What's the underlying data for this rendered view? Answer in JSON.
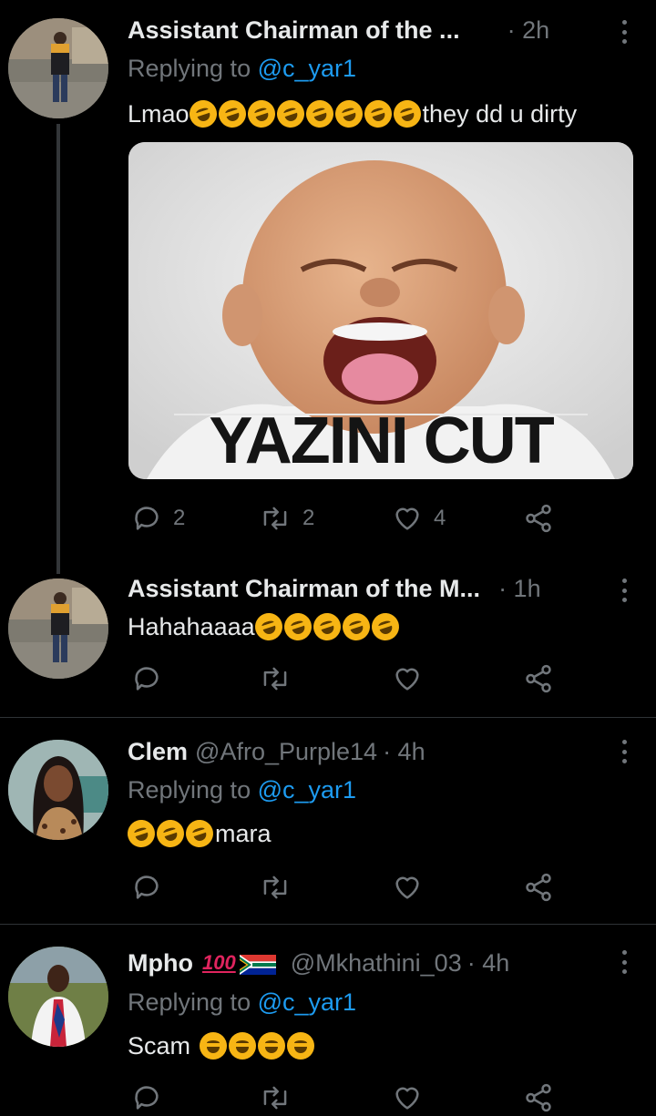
{
  "tweets": [
    {
      "name": "Assistant Chairman of the ...",
      "time": "· 2h",
      "replying_label": "Replying to",
      "replying_handle": "@c_yar1",
      "text_prefix": "Lmao",
      "text_suffix": "they dd u dirty",
      "media_caption": "YAZINI CUT",
      "replies": "2",
      "retweets": "2",
      "likes": "4"
    },
    {
      "name": "Assistant Chairman of the M...",
      "time": "· 1h",
      "text_prefix": "Hahahaaaa"
    },
    {
      "name": "Clem",
      "handle": "@Afro_Purple14",
      "time": "· 4h",
      "replying_label": "Replying to",
      "replying_handle": "@c_yar1",
      "text_suffix": "mara"
    },
    {
      "name": "Mpho",
      "badge": "100",
      "handle": "@Mkhathini_03",
      "time": "· 4h",
      "replying_label": "Replying to",
      "replying_handle": "@c_yar1",
      "text_prefix": "Scam"
    }
  ],
  "icons": {
    "reply": "speech-bubble-icon",
    "retweet": "retweet-arrows-icon",
    "like": "heart-icon",
    "share": "share-nodes-icon",
    "more": "vertical-dots-icon"
  },
  "colors": {
    "background": "#000000",
    "text": "#e7e9ea",
    "muted": "#71767b",
    "link": "#1d9bf0",
    "divider": "#2f3336"
  }
}
